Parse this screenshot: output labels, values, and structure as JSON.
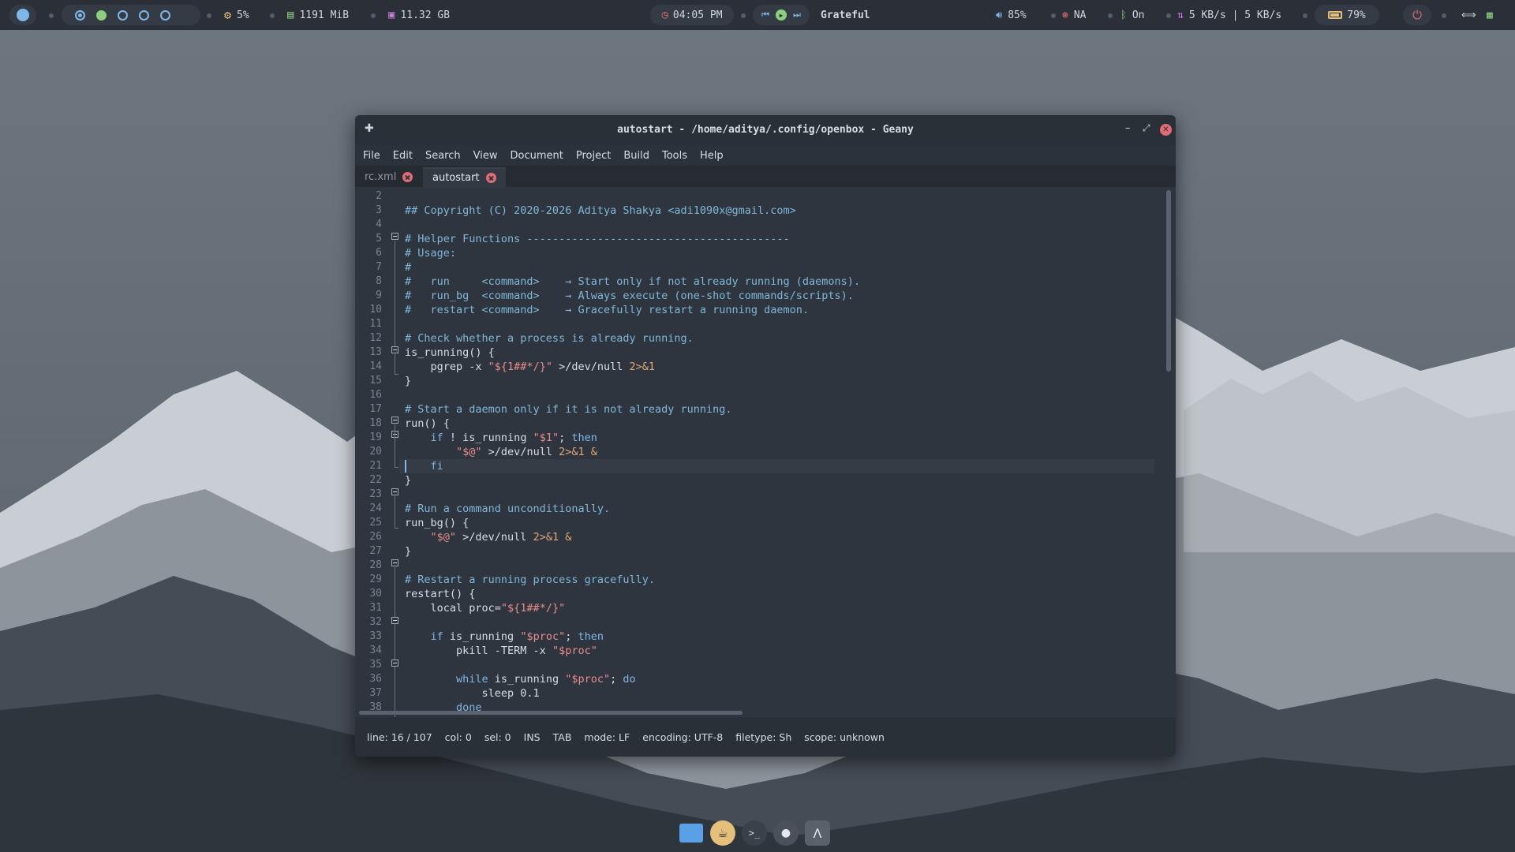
{
  "topbar": {
    "cpu": "5%",
    "memory": "1191 MiB",
    "disk": "11.32 GB",
    "time": "04:05 PM",
    "track": "Grateful",
    "volume": "85%",
    "network_label": "NA",
    "bluetooth": "On",
    "net_speed": "5 KB/s | 5 KB/s",
    "battery": "79%"
  },
  "window": {
    "title": "autostart - /home/aditya/.config/openbox - Geany",
    "menu": [
      "File",
      "Edit",
      "Search",
      "View",
      "Document",
      "Project",
      "Build",
      "Tools",
      "Help"
    ],
    "tabs": [
      {
        "label": "rc.xml",
        "active": false
      },
      {
        "label": "autostart",
        "active": true
      }
    ],
    "line_numbers": [
      "2",
      "3",
      "4",
      "5",
      "6",
      "7",
      "8",
      "9",
      "10",
      "11",
      "12",
      "13",
      "14",
      "15",
      "16",
      "17",
      "18",
      "19",
      "20",
      "21",
      "22",
      "23",
      "24",
      "25",
      "26",
      "27",
      "28",
      "29",
      "30",
      "31",
      "32",
      "33",
      "34",
      "35",
      "36",
      "37",
      "38"
    ],
    "status": {
      "line": "line: 16 / 107",
      "col": "col: 0",
      "sel": "sel: 0",
      "ins": "INS",
      "tab": "TAB",
      "mode": "mode: LF",
      "encoding": "encoding: UTF-8",
      "filetype": "filetype: Sh",
      "scope": "scope: unknown"
    }
  },
  "code": {
    "l3": "## Copyright (C) 2020-2026 Aditya Shakya <adi1090x@gmail.com>",
    "l5": "# Helper Functions -----------------------------------------",
    "l6": "# Usage:",
    "l7": "#",
    "l8": "#   run     <command>    → Start only if not already running (daemons).",
    "l9": "#   run_bg  <command>    → Always execute (one-shot commands/scripts).",
    "l10": "#   restart <command>    → Gracefully restart a running daemon.",
    "l12": "# Check whether a process is already running.",
    "l13": "is_running() {",
    "l14a": "    pgrep -x ",
    "l14b": "\"${1##*/}\"",
    "l14c": " >/dev/null ",
    "l14d": "2>&1",
    "l15": "}",
    "l17": "# Start a daemon only if it is not already running.",
    "l18": "run() {",
    "l19a": "    if",
    "l19b": " ! is_running ",
    "l19c": "\"$1\"",
    "l19d": "; ",
    "l19e": "then",
    "l20a": "        ",
    "l20b": "\"$@\"",
    "l20c": " >/dev/null ",
    "l20d": "2>&1 &",
    "l21": "    fi",
    "l22": "}",
    "l24": "# Run a command unconditionally.",
    "l25": "run_bg() {",
    "l26a": "    ",
    "l26b": "\"$@\"",
    "l26c": " >/dev/null ",
    "l26d": "2>&1 &",
    "l27": "}",
    "l29": "# Restart a running process gracefully.",
    "l30": "restart() {",
    "l31a": "    local proc=",
    "l31b": "\"${1##*/}\"",
    "l33a": "    if",
    "l33b": " is_running ",
    "l33c": "\"$proc\"",
    "l33d": "; ",
    "l33e": "then",
    "l34a": "        pkill -TERM -x ",
    "l34b": "\"$proc\"",
    "l36a": "        while",
    "l36b": " is_running ",
    "l36c": "\"$proc\"",
    "l36d": "; ",
    "l36e": "do",
    "l37": "            sleep 0.1",
    "l38": "        done"
  },
  "colors": {
    "comment": "#7fb7d9",
    "string": "#e78c8c",
    "keyword": "#7fb7e8",
    "close": "#e06c75"
  }
}
